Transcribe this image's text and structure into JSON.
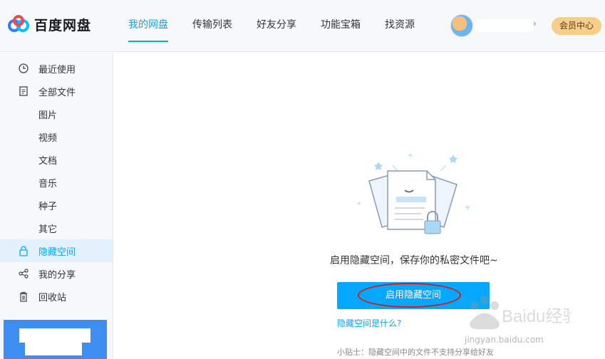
{
  "app": {
    "logo_text": "百度网盘"
  },
  "nav": {
    "items": [
      {
        "label": "我的网盘",
        "active": true
      },
      {
        "label": "传输列表"
      },
      {
        "label": "好友分享"
      },
      {
        "label": "功能宝箱"
      },
      {
        "label": "找资源"
      }
    ]
  },
  "user": {
    "vip_label": "会员中心"
  },
  "sidebar": {
    "items": [
      {
        "label": "最近使用",
        "icon": "clock-icon"
      },
      {
        "label": "全部文件",
        "icon": "file-icon"
      },
      {
        "label": "图片"
      },
      {
        "label": "视频"
      },
      {
        "label": "文档"
      },
      {
        "label": "音乐"
      },
      {
        "label": "种子"
      },
      {
        "label": "其它"
      },
      {
        "label": "隐藏空间",
        "icon": "lock-icon",
        "active": true
      },
      {
        "label": "我的分享",
        "icon": "share-icon"
      },
      {
        "label": "回收站",
        "icon": "trash-icon"
      }
    ]
  },
  "main": {
    "tagline": "启用隐藏空间，保存你的私密文件吧~",
    "enable_button": "启用隐藏空间",
    "help_link": "隐藏空间是什么?",
    "tip": "小贴士：隐藏空间中的文件不支持分享给好友"
  },
  "watermark": {
    "brand": "Baidu经验",
    "url": "jingyan.baidu.com"
  },
  "colors": {
    "accent": "#06a7ff",
    "vip": "#f5ce8a",
    "annotation": "#d61a1a"
  }
}
